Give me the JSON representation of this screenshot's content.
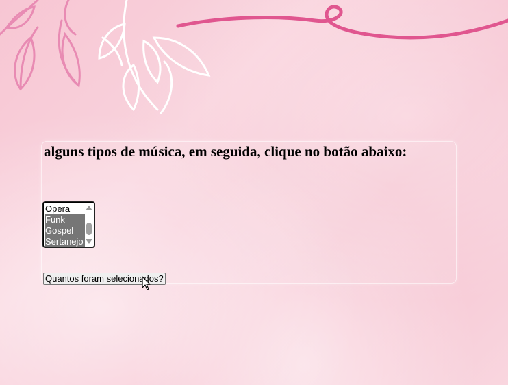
{
  "question": {
    "text": "alguns tipos de música, em seguida, clique no botão abaixo:"
  },
  "music_list": {
    "options": [
      {
        "label": "Opera",
        "selected": false
      },
      {
        "label": "Funk",
        "selected": true
      },
      {
        "label": "Gospel",
        "selected": true
      },
      {
        "label": "Sertanejo",
        "selected": true
      }
    ]
  },
  "count_button": {
    "label": "Quantos foram selecionados?"
  },
  "colors": {
    "background": "#f7c6d3",
    "selected_option": "#767676",
    "ribbon": "#e0568f",
    "leaf_pink": "#e88bb3",
    "leaf_white": "#ffffff"
  },
  "icons": [
    "leaf-decoration",
    "ribbon-decoration",
    "mouse-pointer-icon"
  ]
}
